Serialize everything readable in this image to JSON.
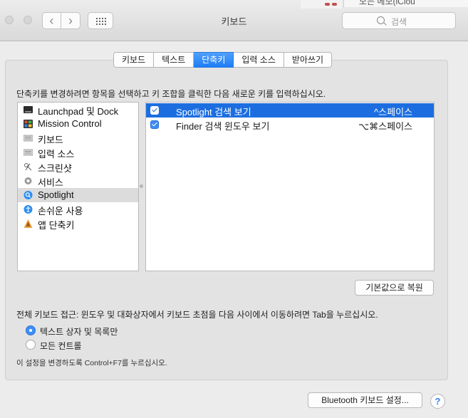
{
  "window": {
    "title": "키보드",
    "search_placeholder": "검색",
    "behind_text": "모든 메모(iClou"
  },
  "tabs": [
    {
      "label": "키보드",
      "active": false
    },
    {
      "label": "텍스트",
      "active": false
    },
    {
      "label": "단축키",
      "active": true
    },
    {
      "label": "입력 소스",
      "active": false
    },
    {
      "label": "받아쓰기",
      "active": false
    }
  ],
  "instructions": "단축키를 변경하려면 항목을 선택하고 키 조합을 클릭한 다음 새로운 키를 입력하십시오.",
  "categories": [
    {
      "label": "Launchpad 및 Dock",
      "icon": "launchpad-icon",
      "selected": false
    },
    {
      "label": "Mission Control",
      "icon": "mission-control-icon",
      "selected": false
    },
    {
      "label": "키보드",
      "icon": "keyboard-icon",
      "selected": false
    },
    {
      "label": "입력 소스",
      "icon": "keyboard-icon",
      "selected": false
    },
    {
      "label": "스크린샷",
      "icon": "screenshot-icon",
      "selected": false
    },
    {
      "label": "서비스",
      "icon": "gear-icon",
      "selected": false
    },
    {
      "label": "Spotlight",
      "icon": "spotlight-icon",
      "selected": true
    },
    {
      "label": "손쉬운 사용",
      "icon": "accessibility-icon",
      "selected": false
    },
    {
      "label": "앱 단축키",
      "icon": "app-shortcuts-icon",
      "selected": false
    }
  ],
  "shortcuts": [
    {
      "label": "Spotlight 검색 보기",
      "keys": "^스페이스",
      "checked": true,
      "selected": true
    },
    {
      "label": "Finder 검색 윈도우 보기",
      "keys": "⌥⌘스페이스",
      "checked": true,
      "selected": false
    }
  ],
  "restore_defaults_label": "기본값으로 복원",
  "full_keyboard_access": {
    "text": "전체 키보드 접근: 윈도우 및 대화상자에서 키보드 초점을 다음 사이에서 이동하려면 Tab을 누르십시오.",
    "options": [
      {
        "label": "텍스트 상자 및 목록만",
        "selected": true
      },
      {
        "label": "모든 컨트롤",
        "selected": false
      }
    ],
    "hint": "이 설정을 변경하도록 Control+F7를 누르십시오."
  },
  "bluetooth_button_label": "Bluetooth 키보드 설정...",
  "help_label": "?",
  "colors": {
    "accent": "#1c6ee0",
    "tab_active": "#2a84f7"
  }
}
